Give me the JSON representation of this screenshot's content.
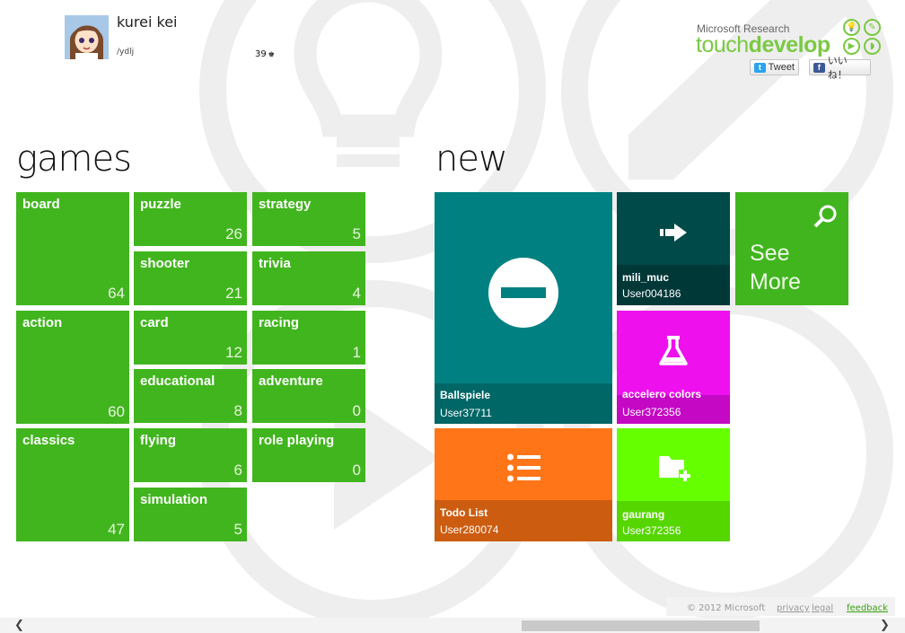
{
  "user": {
    "name": "kurei kei",
    "id": "/ydlj",
    "score": "39"
  },
  "brand": {
    "small": "Microsoft Research",
    "big_light": "touch",
    "big_bold": "develop"
  },
  "share": {
    "tweet": "Tweet",
    "like": "いいね！"
  },
  "games": {
    "title": "games",
    "tiles": [
      {
        "name": "board",
        "count": "64"
      },
      {
        "name": "puzzle",
        "count": "26"
      },
      {
        "name": "strategy",
        "count": "5"
      },
      {
        "name": "shooter",
        "count": "21"
      },
      {
        "name": "trivia",
        "count": "4"
      },
      {
        "name": "action",
        "count": "60"
      },
      {
        "name": "card",
        "count": "12"
      },
      {
        "name": "racing",
        "count": "1"
      },
      {
        "name": "educational",
        "count": "8"
      },
      {
        "name": "adventure",
        "count": "0"
      },
      {
        "name": "classics",
        "count": "47"
      },
      {
        "name": "flying",
        "count": "6"
      },
      {
        "name": "role playing",
        "count": "0"
      },
      {
        "name": "simulation",
        "count": "5"
      }
    ]
  },
  "new": {
    "title": "new",
    "tiles": [
      {
        "name": "Ballspiele",
        "user": "User37711",
        "icon": "minus-circle-icon",
        "color": "#008080",
        "band": "#006666"
      },
      {
        "name": "mili_muc",
        "user": "User004186",
        "icon": "arrow-right-icon",
        "color": "#004a4a",
        "band": "#003838"
      },
      {
        "name": "accelero colors",
        "user": "User372356",
        "icon": "flask-icon",
        "color": "#ee11ee",
        "band": "#c408c4"
      },
      {
        "name": "Todo List",
        "user": "User280074",
        "icon": "list-icon",
        "color": "#ff7518",
        "band": "#cc5c10"
      },
      {
        "name": "gaurang",
        "user": "User372356",
        "icon": "folder-add-icon",
        "color": "#66ff00",
        "band": "#55d600"
      }
    ],
    "see_more": {
      "line1": "See",
      "line2": "More",
      "color": "#41b51e"
    }
  },
  "footer": {
    "copyright": "© 2012 Microsoft",
    "privacy": "privacy",
    "legal": "legal",
    "feedback": "feedback"
  }
}
